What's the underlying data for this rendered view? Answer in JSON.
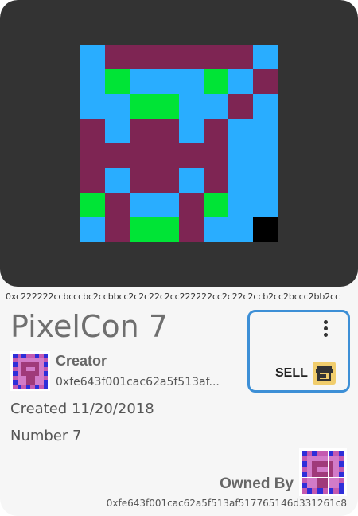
{
  "pixelcon": {
    "hex_id": "0xc222222ccbcccbc2ccbbcc2c2c22c2cc222222cc2c22c2ccb2cc2bccc2bb2cc",
    "title": "PixelCon 7",
    "created": "Created 11/20/2018",
    "number": "Number 7"
  },
  "creator": {
    "label": "Creator",
    "address": "0xfe643f001cac62a5f513af..."
  },
  "owner": {
    "label": "Owned By",
    "address": "0xfe643f001cac62a5f513af517765146d331261c8"
  },
  "actions": {
    "sell_label": "SELL",
    "menu_icon": "more-vert-icon",
    "store_icon": "store-icon"
  },
  "colors": {
    "accent_border": "#3d8fd6",
    "sell_icon_bg": "#f1cd6c",
    "art_bg": "#333333"
  }
}
